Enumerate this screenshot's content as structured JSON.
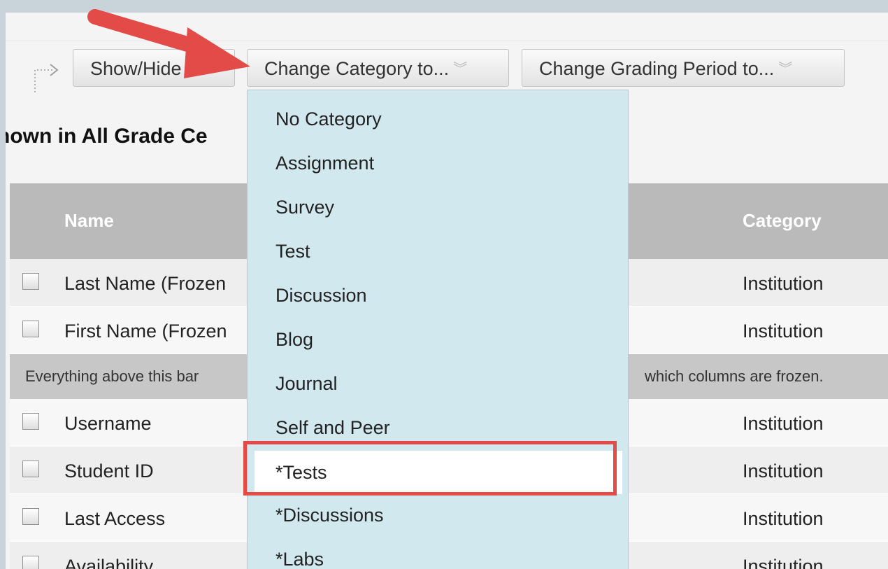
{
  "toolbar": {
    "show_hide_label": "Show/Hide",
    "change_category_label": "Change Category to...",
    "change_period_label": "Change Grading Period to...",
    "chevron_glyph": "︾"
  },
  "page": {
    "heading": "nown in All Grade Ce"
  },
  "table": {
    "headers": {
      "name": "Name",
      "category": "Category"
    },
    "rows": [
      {
        "name": "Last Name (Frozen",
        "category": "Institution"
      },
      {
        "name": "First Name (Frozen",
        "category": "Institution"
      },
      {
        "name": "Username",
        "category": "Institution"
      },
      {
        "name": "Student ID",
        "category": "Institution"
      },
      {
        "name": "Last Access",
        "category": "Institution"
      },
      {
        "name": "Availability",
        "category": "Institution"
      }
    ],
    "freeze_bar": {
      "left": "Everything above this bar",
      "right": "which columns are frozen."
    }
  },
  "category_menu": {
    "items": [
      "No Category",
      "Assignment",
      "Survey",
      "Test",
      "Discussion",
      "Blog",
      "Journal",
      "Self and Peer",
      "*Tests",
      "*Discussions",
      "*Labs"
    ],
    "selected_index": 8
  },
  "annotations": {
    "arrow_color": "#e24b48",
    "highlight_color": "#e24b48"
  }
}
